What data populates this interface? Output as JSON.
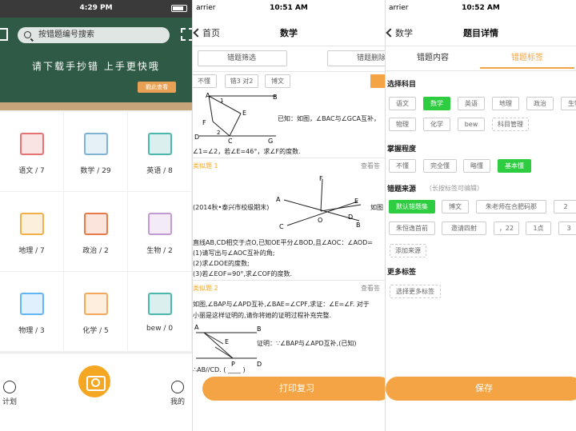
{
  "pane1": {
    "status_time": "4:29 PM",
    "search_placeholder": "按错题编号搜索",
    "banner_slogan": "请下载手抄错 上手更快哦",
    "banner_button": "戳此查看",
    "subjects": [
      {
        "label": "语文 / 7",
        "color": "#e57373"
      },
      {
        "label": "数学 / 29",
        "color": "#7fb3d5"
      },
      {
        "label": "英语 / 8",
        "color": "#4db6ac"
      },
      {
        "label": "地理 / 7",
        "color": "#f0b14a"
      },
      {
        "label": "政治 / 2",
        "color": "#e57a4a"
      },
      {
        "label": "生物 / 2",
        "color": "#c39bd3"
      },
      {
        "label": "物理 / 3",
        "color": "#64b5f6"
      },
      {
        "label": "化学 / 5",
        "color": "#f3a85b"
      },
      {
        "label": "bew / 0",
        "color": "#4db6ac"
      }
    ],
    "tab_plan": "计划",
    "tab_mine": "我的"
  },
  "pane2": {
    "carrier": "arrier",
    "status_time": "10:51 AM",
    "back_label": "首页",
    "title": "数学",
    "filter_label": "错题筛选",
    "delete_label": "错题删除",
    "tags": [
      "不懂",
      "错3 对2",
      "博文"
    ],
    "q1_line1": "已知：如图，∠BAC与∠GCA互补，",
    "q1_line2": "∠1=∠2，若∠E=46°，求∠F的度数.",
    "similar1": "类似题 1",
    "look1": "查看答",
    "s1_line1": "(2014秋•泰兴市校级期末)",
    "s1_side": "如图",
    "s1_line2": "直线AB,CD相交于点O,已知OE平分∠BOD,且∠AOC：∠AOD=",
    "s1_line3": "(1)请写出与∠AOC互补的角;",
    "s1_line4": "(2)求∠DOE的度数;",
    "s1_line5": "(3)若∠EOF=90°,求∠COF的度数.",
    "similar2": "类似题 2",
    "look2": "查看答",
    "s2_line1": "如图,∠BAP与∠APD互补,∠BAE=∠CPF,求证：∠E=∠F. 对于",
    "s2_line2": "小丽是这样证明的,请你将她的证明过程补充完整.",
    "s2_line3": "证明：∵∠BAP与∠APD互补,(已知)",
    "s2_line4": "∴AB//CD. (  ____  )",
    "print_label": "打印复习",
    "pts": [
      "A",
      "B",
      "E",
      "F",
      "C",
      "G",
      "D",
      "1",
      "2"
    ],
    "pts2": [
      "F",
      "A",
      "E",
      "O",
      "B",
      "C",
      "D"
    ],
    "pts3": [
      "A",
      "B",
      "E",
      "P",
      "D"
    ]
  },
  "pane3": {
    "carrier": "arrier",
    "status_time": "10:52 AM",
    "back_label": "数学",
    "title": "题目详情",
    "tab_content": "错题内容",
    "tab_tags": "错题标签",
    "sec_subject": "选择科目",
    "subjects_row1": [
      "语文",
      "数学",
      "英语",
      "地理",
      "政治",
      "生物"
    ],
    "subjects_row2": [
      "物理",
      "化学",
      "bew",
      "科目管理"
    ],
    "sec_level": "掌握程度",
    "levels": [
      "不懂",
      "完全懂",
      "略懂",
      "基本懂"
    ],
    "sec_source": "错题来源",
    "source_hint": "（长按标签可编辑）",
    "sources_row1": [
      "默认错题集",
      "博文",
      "朱老师在合肥码那",
      "2"
    ],
    "sources_row2": [
      "朱恒逸首前",
      "邀请四射",
      "，22",
      "1点",
      "3"
    ],
    "add_source": "添加来源",
    "sec_more": "更多标签",
    "more_tags": "选择更多标签",
    "save_label": "保存",
    "green": "#2ecc40",
    "orange": "#f5a445"
  }
}
